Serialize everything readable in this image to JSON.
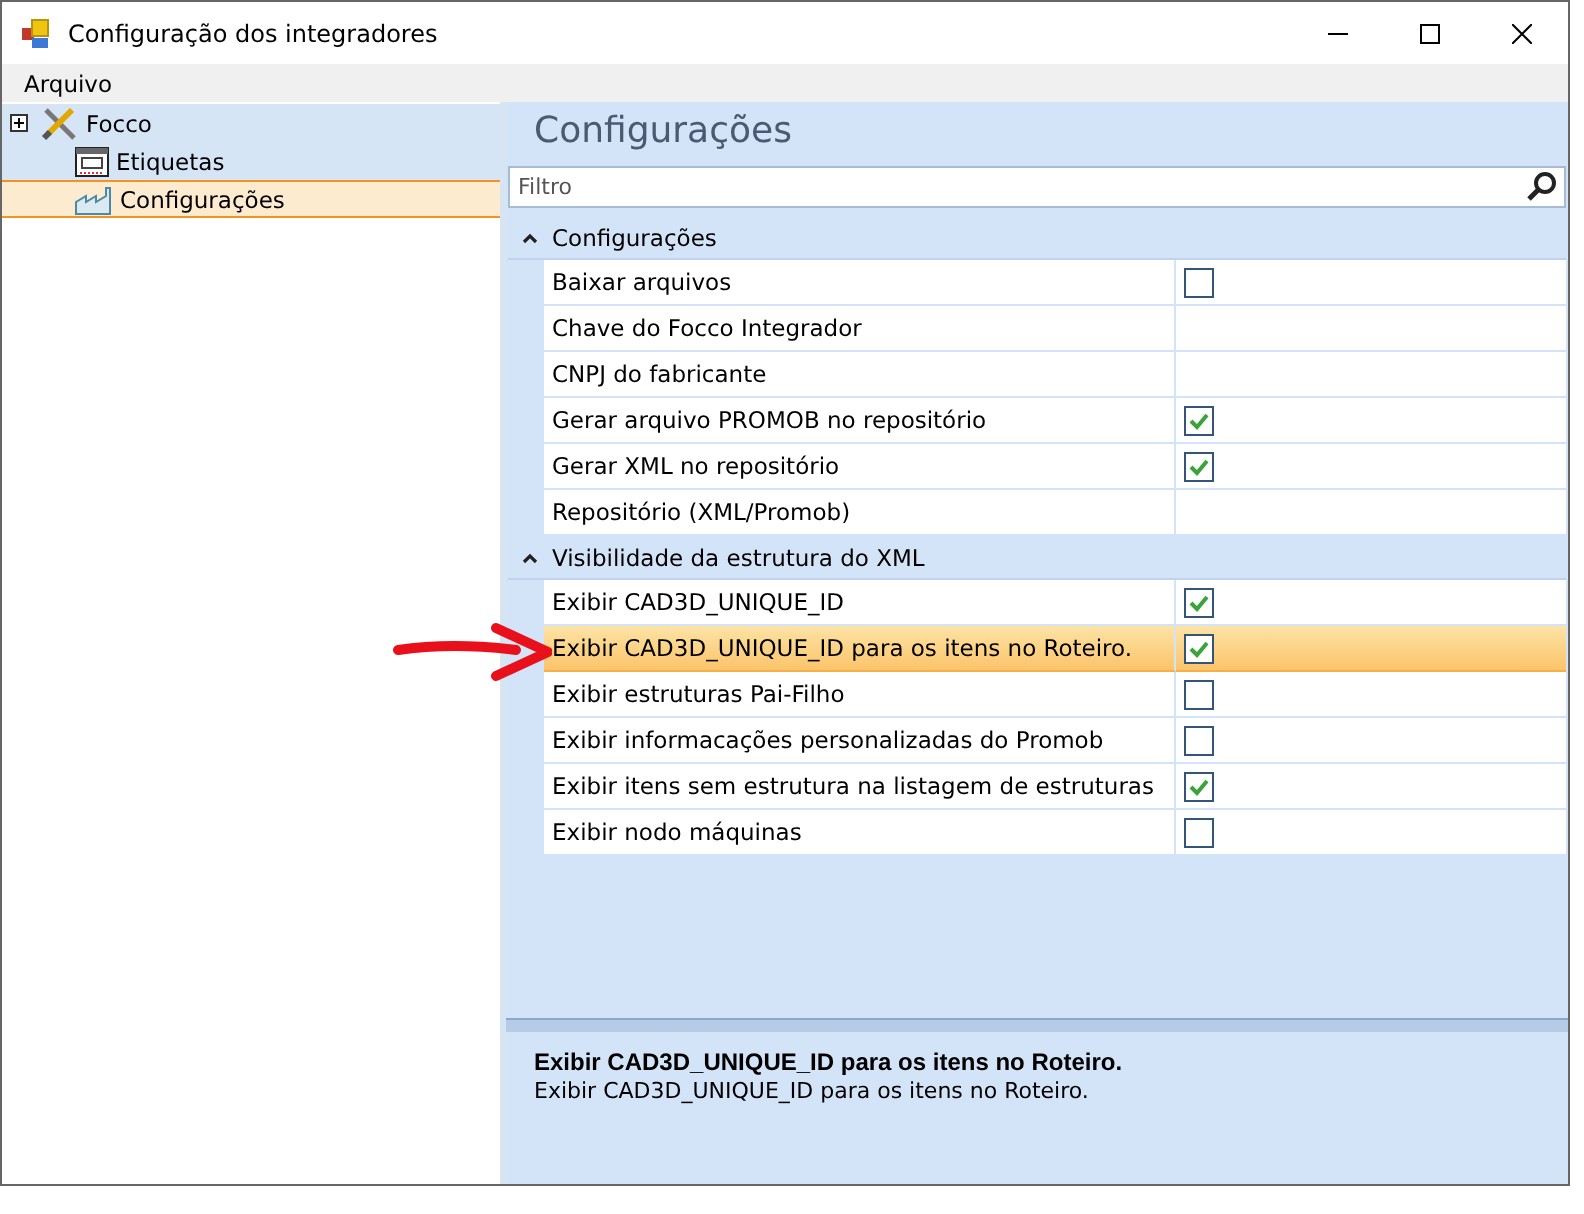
{
  "window": {
    "title": "Configuração dos integradores"
  },
  "menu": [
    "Arquivo"
  ],
  "tree": [
    {
      "label": "Focco",
      "expanded": false,
      "selected": false,
      "children": [
        {
          "label": "Etiquetas",
          "selected": false
        },
        {
          "label": "Configurações",
          "selected": true
        }
      ]
    }
  ],
  "heading": "Configurações",
  "filter": {
    "placeholder": "Filtro"
  },
  "categories": [
    {
      "label": "Configurações",
      "expanded": true,
      "properties": [
        {
          "name": "Baixar arquivos",
          "kind": "checkbox",
          "checked": false,
          "selected": false
        },
        {
          "name": "Chave do Focco Integrador",
          "kind": "text",
          "selected": false
        },
        {
          "name": "CNPJ do fabricante",
          "kind": "text",
          "selected": false
        },
        {
          "name": "Gerar arquivo PROMOB no repositório",
          "kind": "checkbox",
          "checked": true,
          "selected": false
        },
        {
          "name": "Gerar XML no repositório",
          "kind": "checkbox",
          "checked": true,
          "selected": false
        },
        {
          "name": "Repositório (XML/Promob)",
          "kind": "text",
          "selected": false
        }
      ]
    },
    {
      "label": "Visibilidade da estrutura do XML",
      "expanded": true,
      "properties": [
        {
          "name": "Exibir CAD3D_UNIQUE_ID",
          "kind": "checkbox",
          "checked": true,
          "selected": false
        },
        {
          "name": "Exibir CAD3D_UNIQUE_ID para os itens no Roteiro.",
          "kind": "checkbox",
          "checked": true,
          "selected": true
        },
        {
          "name": "Exibir estruturas Pai-Filho",
          "kind": "checkbox",
          "checked": false,
          "selected": false
        },
        {
          "name": "Exibir informacações personalizadas do Promob",
          "kind": "checkbox",
          "checked": false,
          "selected": false
        },
        {
          "name": "Exibir itens sem estrutura na listagem de estruturas",
          "kind": "checkbox",
          "checked": true,
          "selected": false
        },
        {
          "name": "Exibir nodo máquinas",
          "kind": "checkbox",
          "checked": false,
          "selected": false
        }
      ]
    }
  ],
  "description": {
    "title": "Exibir CAD3D_UNIQUE_ID para os itens no Roteiro.",
    "text": "Exibir CAD3D_UNIQUE_ID para os itens no Roteiro."
  }
}
